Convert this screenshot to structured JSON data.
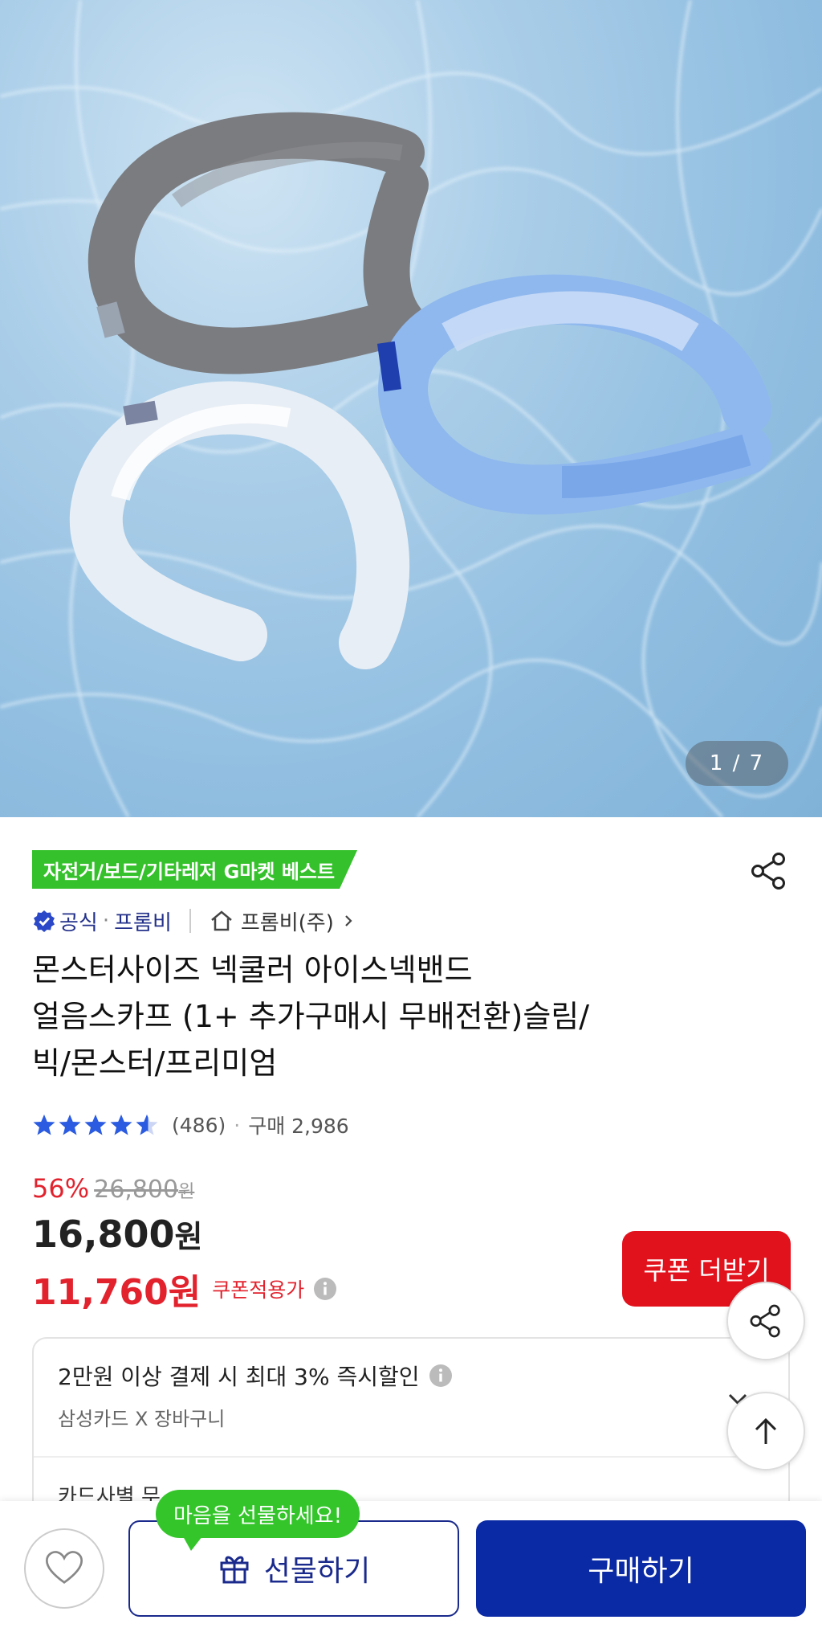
{
  "hero": {
    "counter": "1 / 7"
  },
  "badge": {
    "label": "자전거/보드/기타레저 G마켓 베스트"
  },
  "seller": {
    "official": "공식",
    "brand": "프롬비",
    "shop": "프롬비(주)"
  },
  "product": {
    "title_line1": "몬스터사이즈 넥쿨러 아이스넥밴드",
    "title_line2": "얼음스카프 (1+ 추가구매시 무배전환)슬림/",
    "title_line3": "빅/몬스터/프리미엄"
  },
  "rating": {
    "score": 4.5,
    "reviews": "(486)",
    "purchases": "구매 2,986"
  },
  "pricing": {
    "discount": "56%",
    "original": "26,800",
    "original_unit": "원",
    "price": "16,800",
    "price_unit": "원",
    "coupon_price": "11,760원",
    "coupon_label": "쿠폰적용가",
    "coupon_button": "쿠폰 더받기"
  },
  "card_benefits": {
    "line1": "2만원 이상 결제 시 최대 3% 즉시할인",
    "line2": "삼성카드 X 장바구니",
    "line3": "카드사별 무"
  },
  "bottom": {
    "tooltip": "마음을 선물하세요!",
    "gift_button": "선물하기",
    "buy_button": "구매하기"
  },
  "colors": {
    "badge_green": "#35c12b",
    "price_red": "#e2232e",
    "buy_blue": "#0a2aa5",
    "seller_navy": "#23318a"
  }
}
